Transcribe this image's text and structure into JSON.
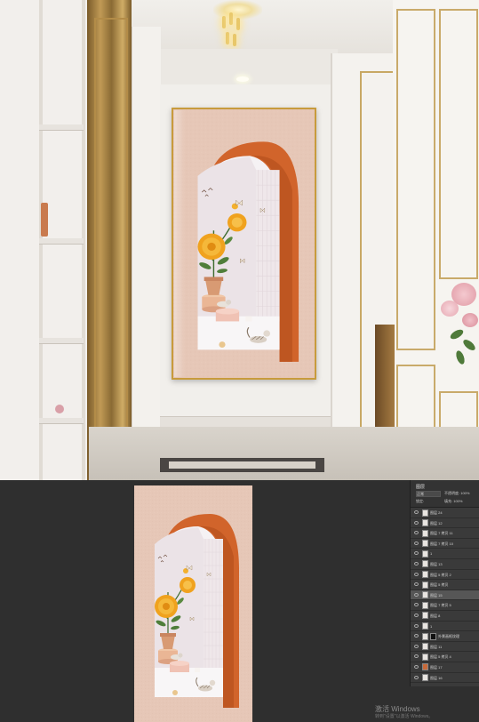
{
  "layers_panel": {
    "tabs": "图层",
    "mode": "正常",
    "opacity": "不透明度: 100%",
    "lock": "锁定:",
    "fill": "填充: 100%",
    "layers": [
      {
        "name": "图层 24",
        "thumb": "plain",
        "mask": false,
        "selected": false
      },
      {
        "name": "图层 12",
        "thumb": "plain",
        "mask": false,
        "selected": false
      },
      {
        "name": "图层 7 拷贝 11",
        "thumb": "plain",
        "mask": false,
        "selected": false
      },
      {
        "name": "图层 7 拷贝 10",
        "thumb": "plain",
        "mask": false,
        "selected": false
      },
      {
        "name": "1",
        "thumb": "plain",
        "mask": false,
        "selected": false
      },
      {
        "name": "图层 13",
        "thumb": "plain",
        "mask": false,
        "selected": false
      },
      {
        "name": "图层 5 拷贝 2",
        "thumb": "plain",
        "mask": false,
        "selected": false
      },
      {
        "name": "图层 5 拷贝",
        "thumb": "plain",
        "mask": false,
        "selected": false
      },
      {
        "name": "图层 15",
        "thumb": "plain",
        "mask": false,
        "selected": true
      },
      {
        "name": "图层 7 拷贝 5",
        "thumb": "plain",
        "mask": false,
        "selected": false
      },
      {
        "name": "图层 8",
        "thumb": "plain",
        "mask": false,
        "selected": false
      },
      {
        "name": "1",
        "thumb": "plain",
        "mask": false,
        "selected": false
      },
      {
        "name": "外景画框纹理",
        "thumb": "plain",
        "mask": true,
        "selected": false
      },
      {
        "name": "图层 11",
        "thumb": "plain",
        "mask": false,
        "selected": false
      },
      {
        "name": "图层 5 拷贝 4",
        "thumb": "plain",
        "mask": false,
        "selected": false
      },
      {
        "name": "图层 17",
        "thumb": "orange",
        "mask": false,
        "selected": false
      },
      {
        "name": "图层 16",
        "thumb": "plain",
        "mask": false,
        "selected": false
      }
    ]
  },
  "watermark": {
    "title": "激活 Windows",
    "subtitle": "转到\"设置\"以激活 Windows。"
  },
  "colors": {
    "art_background": "#e6c7b7",
    "arch_orange": "#d1642b",
    "frame_gold": "#c89b3c",
    "flower_yellow": "#f0a21e"
  }
}
